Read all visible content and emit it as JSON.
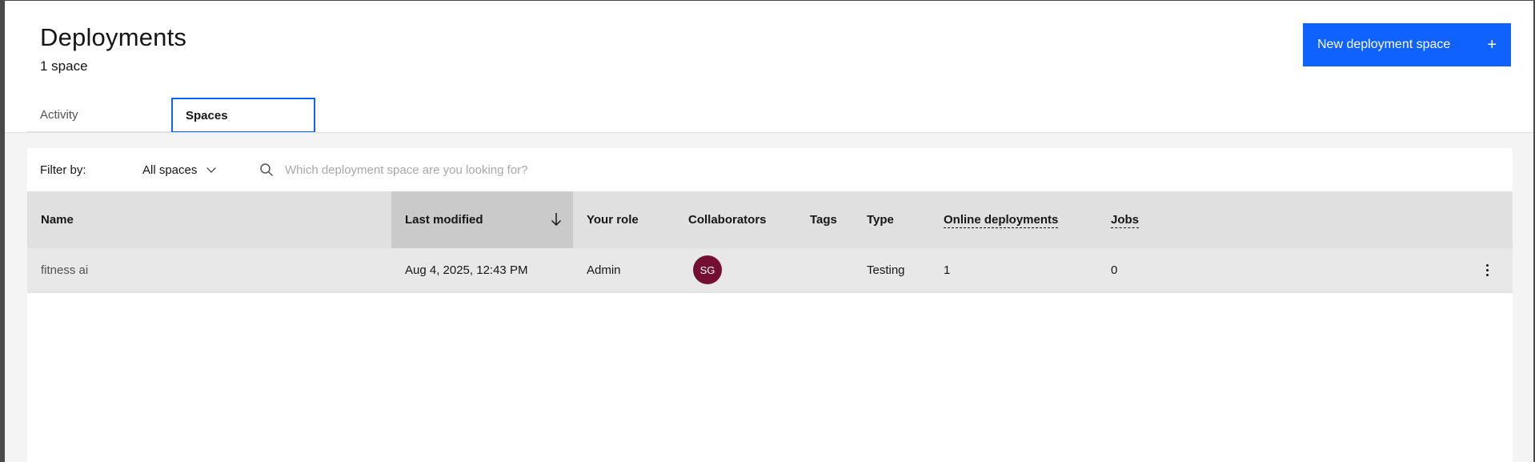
{
  "header": {
    "title": "Deployments",
    "subtitle": "1 space",
    "new_button_label": "New deployment space",
    "new_button_icon": "plus-icon"
  },
  "tabs": [
    {
      "label": "Activity",
      "active": false
    },
    {
      "label": "Spaces",
      "active": true
    }
  ],
  "toolbar": {
    "filter_label": "Filter by:",
    "filter_value": "All spaces",
    "search_placeholder": "Which deployment space are you looking for?",
    "search_value": ""
  },
  "table": {
    "columns": [
      {
        "label": "Name"
      },
      {
        "label": "Last modified",
        "sorted": "descending"
      },
      {
        "label": "Your role"
      },
      {
        "label": "Collaborators"
      },
      {
        "label": "Tags"
      },
      {
        "label": "Type"
      },
      {
        "label": "Online deployments"
      },
      {
        "label": "Jobs"
      }
    ],
    "rows": [
      {
        "name": "fitness ai",
        "last_modified": "Aug 4, 2025, 12:43 PM",
        "role": "Admin",
        "collaborator_initials": "SG",
        "tags": "",
        "type": "Testing",
        "online_deployments": "1",
        "jobs": "0"
      }
    ]
  },
  "colors": {
    "primary": "#0f62fe",
    "avatar": "#750e33",
    "header_bg": "#e0e0e0",
    "sorted_header_bg": "#cacaca",
    "row_bg": "#e8e8e8"
  }
}
